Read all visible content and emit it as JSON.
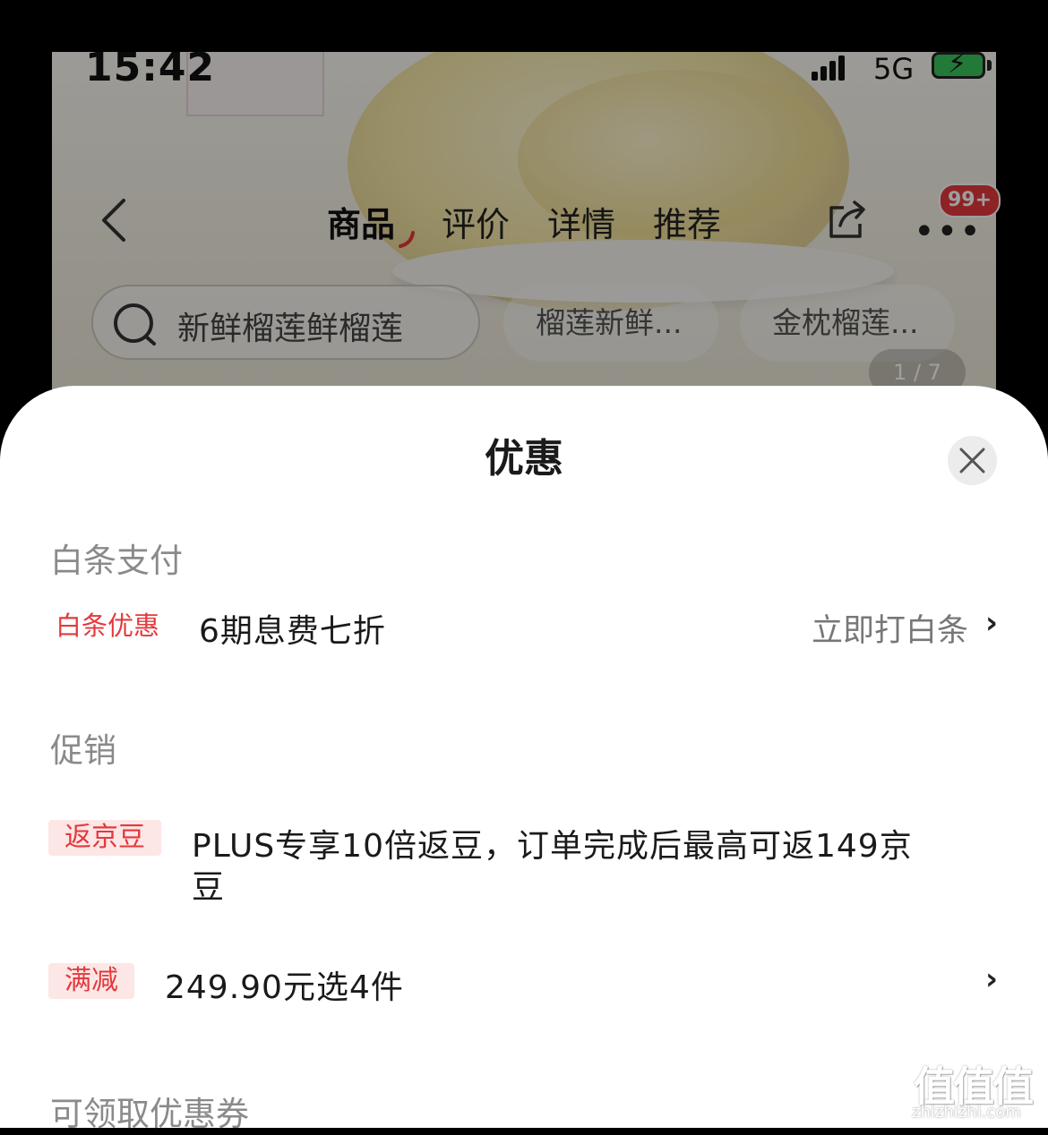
{
  "status_bar": {
    "time": "15:42",
    "network": "5G"
  },
  "product_nav": {
    "tabs": [
      "商品",
      "评价",
      "详情",
      "推荐"
    ],
    "active_tab": "商品",
    "more_badge": "99+"
  },
  "search": {
    "query": "新鲜榴莲鲜榴莲",
    "chips": [
      "榴莲新鲜...",
      "金枕榴莲..."
    ]
  },
  "sheet": {
    "title": "优惠",
    "baitiao": {
      "section": "白条支付",
      "tag": "白条优惠",
      "text": "6期息费七折",
      "link": "立即打白条"
    },
    "promo": {
      "section": "促销",
      "items": [
        {
          "tag": "返京豆",
          "text": "PLUS专享10倍返豆，订单完成后最高可返149京",
          "text2": "豆"
        },
        {
          "tag": "满减",
          "text": "249.90元选4件"
        }
      ]
    },
    "coupons_section": "可领取优惠券"
  },
  "watermark": {
    "logo": "值值值",
    "url": "zhizhizhi.com"
  },
  "colors": {
    "accent_red": "#e4393c",
    "tag_bg": "#fde6e6"
  }
}
